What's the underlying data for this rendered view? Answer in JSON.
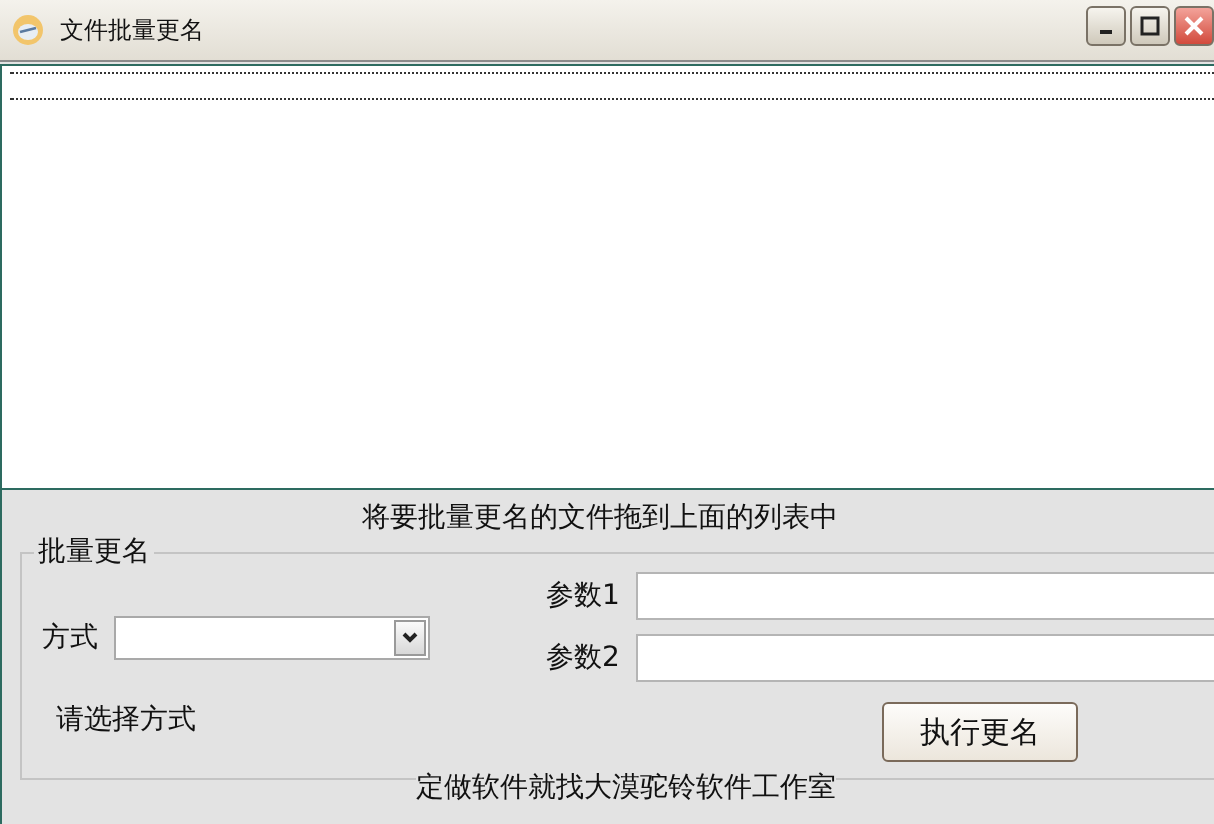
{
  "window": {
    "title": "文件批量更名"
  },
  "file_list": {
    "hint": "将要批量更名的文件拖到上面的列表中"
  },
  "group": {
    "title": "批量更名",
    "mode_label": "方式",
    "mode_status": "请选择方式",
    "param1_label": "参数1",
    "param2_label": "参数2",
    "run_button": "执行更名"
  },
  "footer": "定做软件就找大漠驼铃软件工作室"
}
